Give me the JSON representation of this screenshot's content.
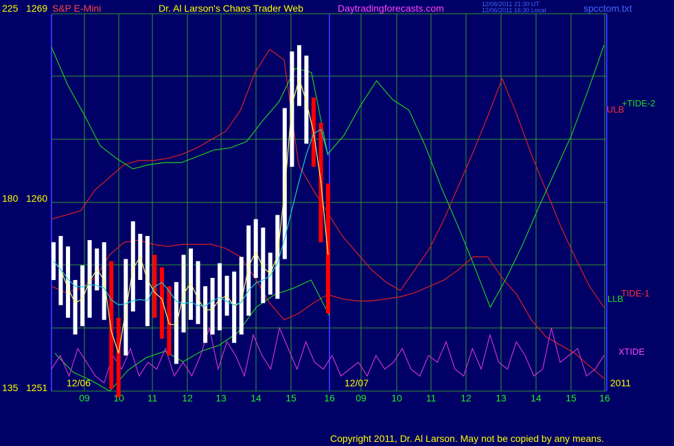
{
  "header": {
    "left_scale": "225",
    "price_top": "1269",
    "symbol": "S&P E-Mini",
    "title": "Dr. Al Larson's Chaos Trader Web",
    "site": "Daytradingforecasts.com",
    "stamp_ut": "12/06/2011 21:30 UT",
    "stamp_local": "12/06/2011 16:30 Local",
    "filename": "spcctom.txt"
  },
  "axis_labels": {
    "mid_scale": "180",
    "price_mid": "1260",
    "bottom_scale": "135",
    "price_bottom": "1251",
    "date_left": "12/06",
    "date_right": "12/07",
    "year": "2011"
  },
  "legend": {
    "tide2": "+TIDE-2",
    "ulb": "ULB",
    "tide1": "TIDE-1",
    "llb": "LLB",
    "xtide": "XTIDE"
  },
  "footer": {
    "copyright": "Copyright 2011, Dr. Al Larson. May not be copied by any means."
  },
  "colors": {
    "background": "#000066",
    "grid": "#339933",
    "price_bar": "#ffffff",
    "down_bar": "#ff0000",
    "ulb": "#dd2222",
    "tide2": "#22cc22",
    "xtide": "#cc33cc",
    "fast_avg": "#ffff66",
    "slow_avg": "#22ccdd",
    "divider": "#3333ff"
  },
  "chart_data": {
    "type": "line",
    "price_range": [
      1251,
      1269
    ],
    "x_ticks": [
      "09",
      "10",
      "11",
      "12",
      "13",
      "14",
      "15",
      "16",
      "09",
      "10",
      "11",
      "12",
      "13",
      "14",
      "15",
      "16"
    ],
    "price_close": [
      1257.2,
      1256.4,
      1255.4,
      1255.0,
      1255.8,
      1256.7,
      1256.9,
      1255.7,
      1252.0,
      1253.6,
      1256.1,
      1257.6,
      1257.2,
      1255.4,
      1256.0,
      1254.8,
      1253.6,
      1254.7,
      1256.6,
      1255.7,
      1255.1,
      1254.6,
      1255.2,
      1255.6,
      1255.5,
      1254.6,
      1255.9,
      1258.0,
      1257.3,
      1256.5,
      1256.7,
      1258.2,
      1263.0,
      1266.3,
      1265.5,
      1264.1,
      1262.6,
      1259.4,
      1255.6
    ],
    "ulb": [
      1259.2,
      1259.4,
      1259.6,
      1260.6,
      1261.2,
      1261.8,
      1262.0,
      1262.0,
      1262.1,
      1262.3,
      1262.6,
      1263.0,
      1263.4,
      1264.4,
      1266.2,
      1267.3,
      1266.8,
      1261.8,
      1260.6,
      1259.5,
      1258.4,
      1257.6,
      1256.8,
      1256.2,
      1255.8,
      1256.8,
      1257.8,
      1259.2,
      1260.8,
      1262.4,
      1264.1,
      1265.9,
      1264.2,
      1262.3,
      1260.6,
      1258.9,
      1257.4,
      1256.0,
      1255.0
    ],
    "llb": [
      1256.0,
      1255.7,
      1255.9,
      1256.4,
      1257.5,
      1258.1,
      1258.2,
      1258.0,
      1257.9,
      1258.0,
      1258.0,
      1258.0,
      1257.8,
      1257.4,
      1256.4,
      1255.2,
      1254.4,
      1254.7,
      1255.2,
      1255.6,
      1255.4,
      1255.3,
      1255.3,
      1255.4,
      1255.5,
      1255.7,
      1256.0,
      1256.3,
      1256.8,
      1257.4,
      1257.4,
      1256.4,
      1255.6,
      1254.4,
      1253.6,
      1253.2,
      1252.8,
      1252.2,
      1251.6
    ],
    "tide2": [
      1267.4,
      1265.6,
      1264.2,
      1262.7,
      1262.1,
      1261.6,
      1261.8,
      1261.9,
      1261.9,
      1262.2,
      1262.5,
      1262.6,
      1262.9,
      1263.9,
      1264.8,
      1266.4,
      1266.2,
      1262.3,
      1263.2,
      1264.6,
      1265.8,
      1264.9,
      1264.4,
      1262.7,
      1260.7,
      1258.9,
      1257.0,
      1255.0,
      1256.4,
      1258.0,
      1259.8,
      1261.5,
      1263.2,
      1265.3,
      1267.5
    ],
    "tide1": [
      1252.8,
      1251.9,
      1251.5,
      1251.0,
      1252.0,
      1252.6,
      1252.9,
      1252.4,
      1252.9,
      1253.2,
      1253.8,
      1255.0,
      1255.6,
      1255.9,
      1256.3,
      1254.6
    ],
    "xtide": [
      0.3,
      0.5,
      0.2,
      0.6,
      0.4,
      0.2,
      0.1,
      0.5,
      0.3,
      0.6,
      0.2,
      0.4,
      0.3,
      0.6,
      0.2,
      0.4,
      0.2,
      0.5,
      0.9,
      0.3,
      0.7,
      0.5,
      0.2,
      0.8,
      0.5,
      0.3,
      0.9,
      0.6,
      0.3,
      0.7,
      0.4,
      0.3,
      0.5,
      0.2,
      0.3,
      0.4,
      0.2,
      0.5,
      0.3,
      0.4,
      0.6,
      0.3,
      0.2,
      0.5,
      0.4,
      0.7,
      0.3,
      0.2,
      0.6,
      0.3,
      0.8,
      0.4,
      0.3,
      0.7,
      0.5,
      0.2,
      0.3,
      0.9,
      0.4,
      0.5,
      0.6,
      0.2,
      0.3,
      0.5
    ]
  }
}
